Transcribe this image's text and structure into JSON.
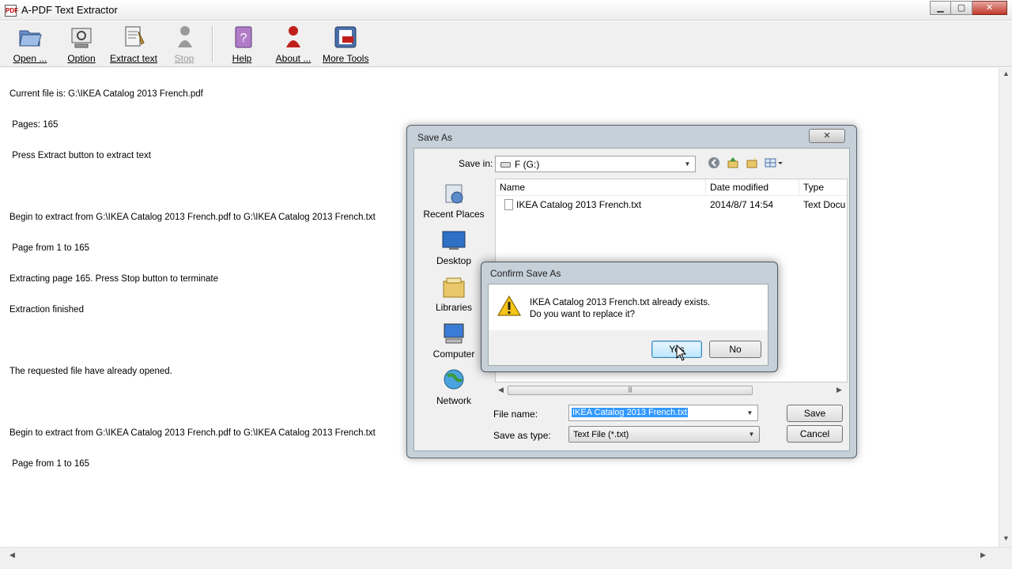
{
  "window": {
    "title": "A-PDF Text Extractor"
  },
  "toolbar": {
    "open": "Open ...",
    "option": "Option",
    "extract": "Extract text",
    "stop": "Stop",
    "help": "Help",
    "about": "About ...",
    "more": "More Tools"
  },
  "log": {
    "lines": [
      "Current file is: G:\\IKEA Catalog 2013 French.pdf",
      " Pages: 165",
      " Press Extract button to extract text",
      "",
      "Begin to extract from G:\\IKEA Catalog 2013 French.pdf to G:\\IKEA Catalog 2013 French.txt",
      " Page from 1 to 165",
      "Extracting page 165. Press Stop button to terminate",
      "Extraction finished",
      "",
      "The requested file have already opened.",
      "",
      "Begin to extract from G:\\IKEA Catalog 2013 French.pdf to G:\\IKEA Catalog 2013 French.txt",
      " Page from 1 to 165"
    ]
  },
  "save_as": {
    "title": "Save As",
    "close": "✕",
    "save_in_label": "Save in:",
    "save_in_value": "F (G:)",
    "places": [
      "Recent Places",
      "Desktop",
      "Libraries",
      "Computer",
      "Network"
    ],
    "columns": [
      "Name",
      "Date modified",
      "Type"
    ],
    "files": [
      {
        "name": "IKEA Catalog 2013 French.txt",
        "date": "2014/8/7 14:54",
        "type": "Text Docu"
      }
    ],
    "file_name_label": "File name:",
    "file_name_value": "IKEA Catalog 2013 French.txt",
    "save_type_label": "Save as type:",
    "save_type_value": "Text File (*.txt)",
    "save_button": "Save",
    "cancel_button": "Cancel"
  },
  "confirm": {
    "title": "Confirm Save As",
    "message_line1": "IKEA Catalog 2013 French.txt already exists.",
    "message_line2": "Do you want to replace it?",
    "yes": "Yes",
    "no": "No"
  },
  "colors": {
    "dialog_frame": "#c6d0d9",
    "selection": "#3399ff",
    "focus_button": "#bde6fd"
  }
}
